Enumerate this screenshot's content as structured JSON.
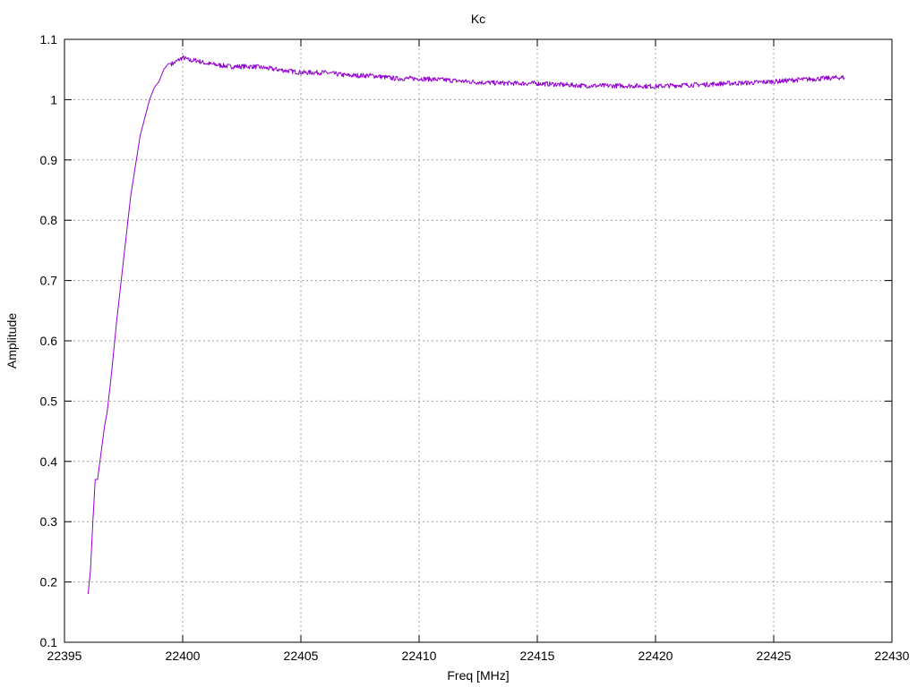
{
  "chart_data": {
    "type": "line",
    "title": "Kc",
    "xlabel": "Freq [MHz]",
    "ylabel": "Amplitude",
    "xlim": [
      22395,
      22430
    ],
    "ylim": [
      0.1,
      1.1
    ],
    "xticks": [
      "22395",
      "22400",
      "22405",
      "22410",
      "22415",
      "22420",
      "22425",
      "22430"
    ],
    "yticks": [
      "0.1",
      "0.2",
      "0.3",
      "0.4",
      "0.5",
      "0.6",
      "0.7",
      "0.8",
      "0.9",
      "1",
      "1.1"
    ],
    "grid": true,
    "line_color": "#9400d3",
    "series": [
      {
        "x": [
          22396.0,
          22396.1,
          22396.2,
          22396.3,
          22396.4,
          22396.5,
          22396.6,
          22396.7,
          22396.8,
          22397.0,
          22397.2,
          22397.4,
          22397.6,
          22397.8,
          22398.0,
          22398.2,
          22398.4,
          22398.6,
          22398.8,
          22399.0,
          22399.2,
          22399.4,
          22399.6,
          22399.8,
          22400.0,
          22400.3,
          22400.6,
          22401.0,
          22402.0,
          22403.0,
          22404.0,
          22405.0,
          22406.0,
          22407.0,
          22408.0,
          22409.0,
          22410.0,
          22411.0,
          22412.0,
          22413.0,
          22414.0,
          22415.0,
          22416.0,
          22417.0,
          22418.0,
          22419.0,
          22420.0,
          22421.0,
          22422.0,
          22423.0,
          22424.0,
          22425.0,
          22426.0,
          22427.0,
          22428.0
        ],
        "y": [
          0.18,
          0.22,
          0.3,
          0.37,
          0.37,
          0.4,
          0.43,
          0.46,
          0.48,
          0.55,
          0.63,
          0.7,
          0.77,
          0.84,
          0.89,
          0.94,
          0.97,
          1.0,
          1.02,
          1.03,
          1.05,
          1.06,
          1.06,
          1.065,
          1.07,
          1.065,
          1.065,
          1.06,
          1.055,
          1.055,
          1.05,
          1.045,
          1.045,
          1.04,
          1.04,
          1.035,
          1.035,
          1.033,
          1.03,
          1.028,
          1.027,
          1.027,
          1.025,
          1.023,
          1.023,
          1.023,
          1.022,
          1.024,
          1.025,
          1.027,
          1.028,
          1.03,
          1.033,
          1.035,
          1.037
        ]
      }
    ]
  }
}
